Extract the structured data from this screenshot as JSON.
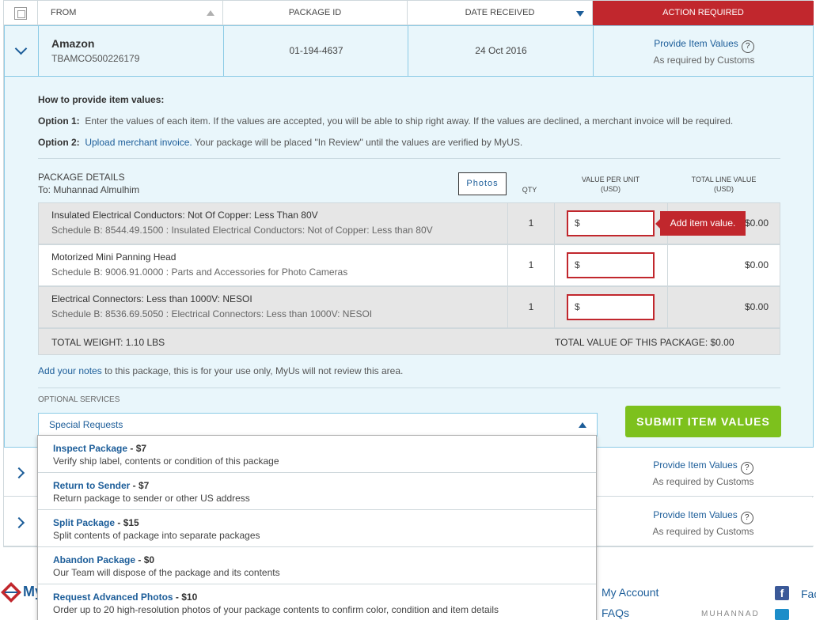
{
  "header": {
    "from": "FROM",
    "package_id": "PACKAGE ID",
    "date_received": "DATE RECEIVED",
    "action_required": "ACTION REQUIRED"
  },
  "expanded": {
    "merchant": "Amazon",
    "tracking": "TBAMCO500226179",
    "package_id": "01-194-4637",
    "date": "24 Oct 2016",
    "action_link": "Provide Item Values",
    "action_sub": "As required by Customs",
    "howto_title": "How to provide item values:",
    "option1_label": "Option 1:",
    "option1_text": "Enter the values of each item. If the values are accepted, you will be able to ship right away. If the values are declined, a merchant invoice will be required.",
    "option2_label": "Option 2:",
    "option2_link": "Upload merchant invoice.",
    "option2_text": "Your package will be placed \"In Review\" until the values are verified by MyUS.",
    "details_title": "PACKAGE DETAILS",
    "details_to": "To: Muhannad Almulhim",
    "photos_btn": "Photos",
    "col_qty": "QTY",
    "col_value_line1": "VALUE PER UNIT",
    "col_value_line2": "(USD)",
    "col_total_line1": "TOTAL LINE VALUE",
    "col_total_line2": "(USD)",
    "items": [
      {
        "desc": "Insulated Electrical Conductors: Not Of Copper: Less Than 80V",
        "sched": "Schedule B: 8544.49.1500 : Insulated Electrical Conductors: Not of Copper: Less than 80V",
        "qty": "1",
        "value": "$",
        "total": "$0.00"
      },
      {
        "desc": "Motorized Mini Panning Head",
        "sched": "Schedule B: 9006.91.0000 : Parts and Accessories for Photo Cameras",
        "qty": "1",
        "value": "$",
        "total": "$0.00"
      },
      {
        "desc": "Electrical Connectors: Less than 1000V: NESOI",
        "sched": "Schedule B: 8536.69.5050 : Electrical Connectors: Less than 1000V: NESOI",
        "qty": "1",
        "value": "$",
        "total": "$0.00"
      }
    ],
    "tooltip": "Add item value.",
    "total_weight": "TOTAL WEIGHT: 1.10 lbs",
    "total_value": "TOTAL VALUE OF THIS PACKAGE: $0.00",
    "notes_link": "Add your notes",
    "notes_text": "to this package, this is for your use only, MyUs will not review this area.",
    "optional_services": "OPTIONAL SERVICES",
    "special_requests": "Special Requests",
    "submit": "SUBMIT ITEM VALUES"
  },
  "dropdown": [
    {
      "name": "Inspect Package",
      "price": " - $7",
      "desc": "Verify ship label, contents or condition of this package"
    },
    {
      "name": "Return to Sender",
      "price": " - $7",
      "desc": "Return package to sender or other US address"
    },
    {
      "name": "Split Package",
      "price": " - $15",
      "desc": "Split contents of package into separate packages"
    },
    {
      "name": "Abandon Package",
      "price": " - $0",
      "desc": "Our Team will dispose of the package and its contents"
    },
    {
      "name": "Request Advanced Photos",
      "price": " - $10",
      "desc": "Order up to 20 high-resolution photos of your package contents to confirm color, condition and item details"
    }
  ],
  "collapsed_rows": [
    {
      "action_link": "Provide Item Values",
      "action_sub": "As required by Customs"
    },
    {
      "action_link": "Provide Item Values",
      "action_sub": "As required by Customs"
    }
  ],
  "footer": {
    "logo_text": "My",
    "my_account": "My Account",
    "faqs": "FAQs",
    "fac": "Fac",
    "watermark": "MUHANNAD"
  },
  "colors": {
    "accent_blue": "#1c5d99",
    "action_red": "#c1272d",
    "submit_green": "#7dc11d",
    "expanded_bg": "#e9f6fb"
  }
}
